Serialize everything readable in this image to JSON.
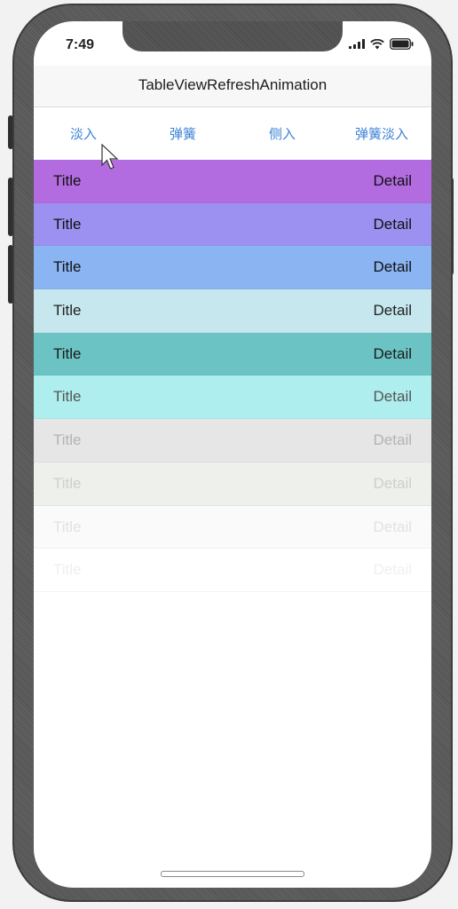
{
  "status_bar": {
    "time": "7:49",
    "icons": [
      "signal-icon",
      "wifi-icon",
      "battery-icon"
    ]
  },
  "nav": {
    "title": "TableViewRefreshAnimation"
  },
  "segments": [
    {
      "label": "淡入"
    },
    {
      "label": "弹簧"
    },
    {
      "label": "侧入"
    },
    {
      "label": "弹簧淡入"
    }
  ],
  "rows": [
    {
      "title": "Title",
      "detail": "Detail",
      "color": "#b26ce0",
      "text_color": "#111111",
      "opacity": 1
    },
    {
      "title": "Title",
      "detail": "Detail",
      "color": "#9c91f0",
      "text_color": "#111111",
      "opacity": 1
    },
    {
      "title": "Title",
      "detail": "Detail",
      "color": "#8ab4f2",
      "text_color": "#111111",
      "opacity": 1
    },
    {
      "title": "Title",
      "detail": "Detail",
      "color": "#c6e7ee",
      "text_color": "#222222",
      "opacity": 1
    },
    {
      "title": "Title",
      "detail": "Detail",
      "color": "#6cc3c4",
      "text_color": "#1a1a1a",
      "opacity": 1
    },
    {
      "title": "Title",
      "detail": "Detail",
      "color": "#aeeeee",
      "text_color": "#555555",
      "opacity": 1
    },
    {
      "title": "Title",
      "detail": "Detail",
      "color": "#e6e6e6",
      "text_color": "#b3b3b3",
      "opacity": 1
    },
    {
      "title": "Title",
      "detail": "Detail",
      "color": "#eef0ec",
      "text_color": "#cfcfcf",
      "opacity": 1
    },
    {
      "title": "Title",
      "detail": "Detail",
      "color": "#fafafa",
      "text_color": "#e2e2e2",
      "opacity": 1
    },
    {
      "title": "Title",
      "detail": "Detail",
      "color": "#ffffff",
      "text_color": "#efefef",
      "opacity": 1
    }
  ],
  "accent_color": "#3b82d6"
}
